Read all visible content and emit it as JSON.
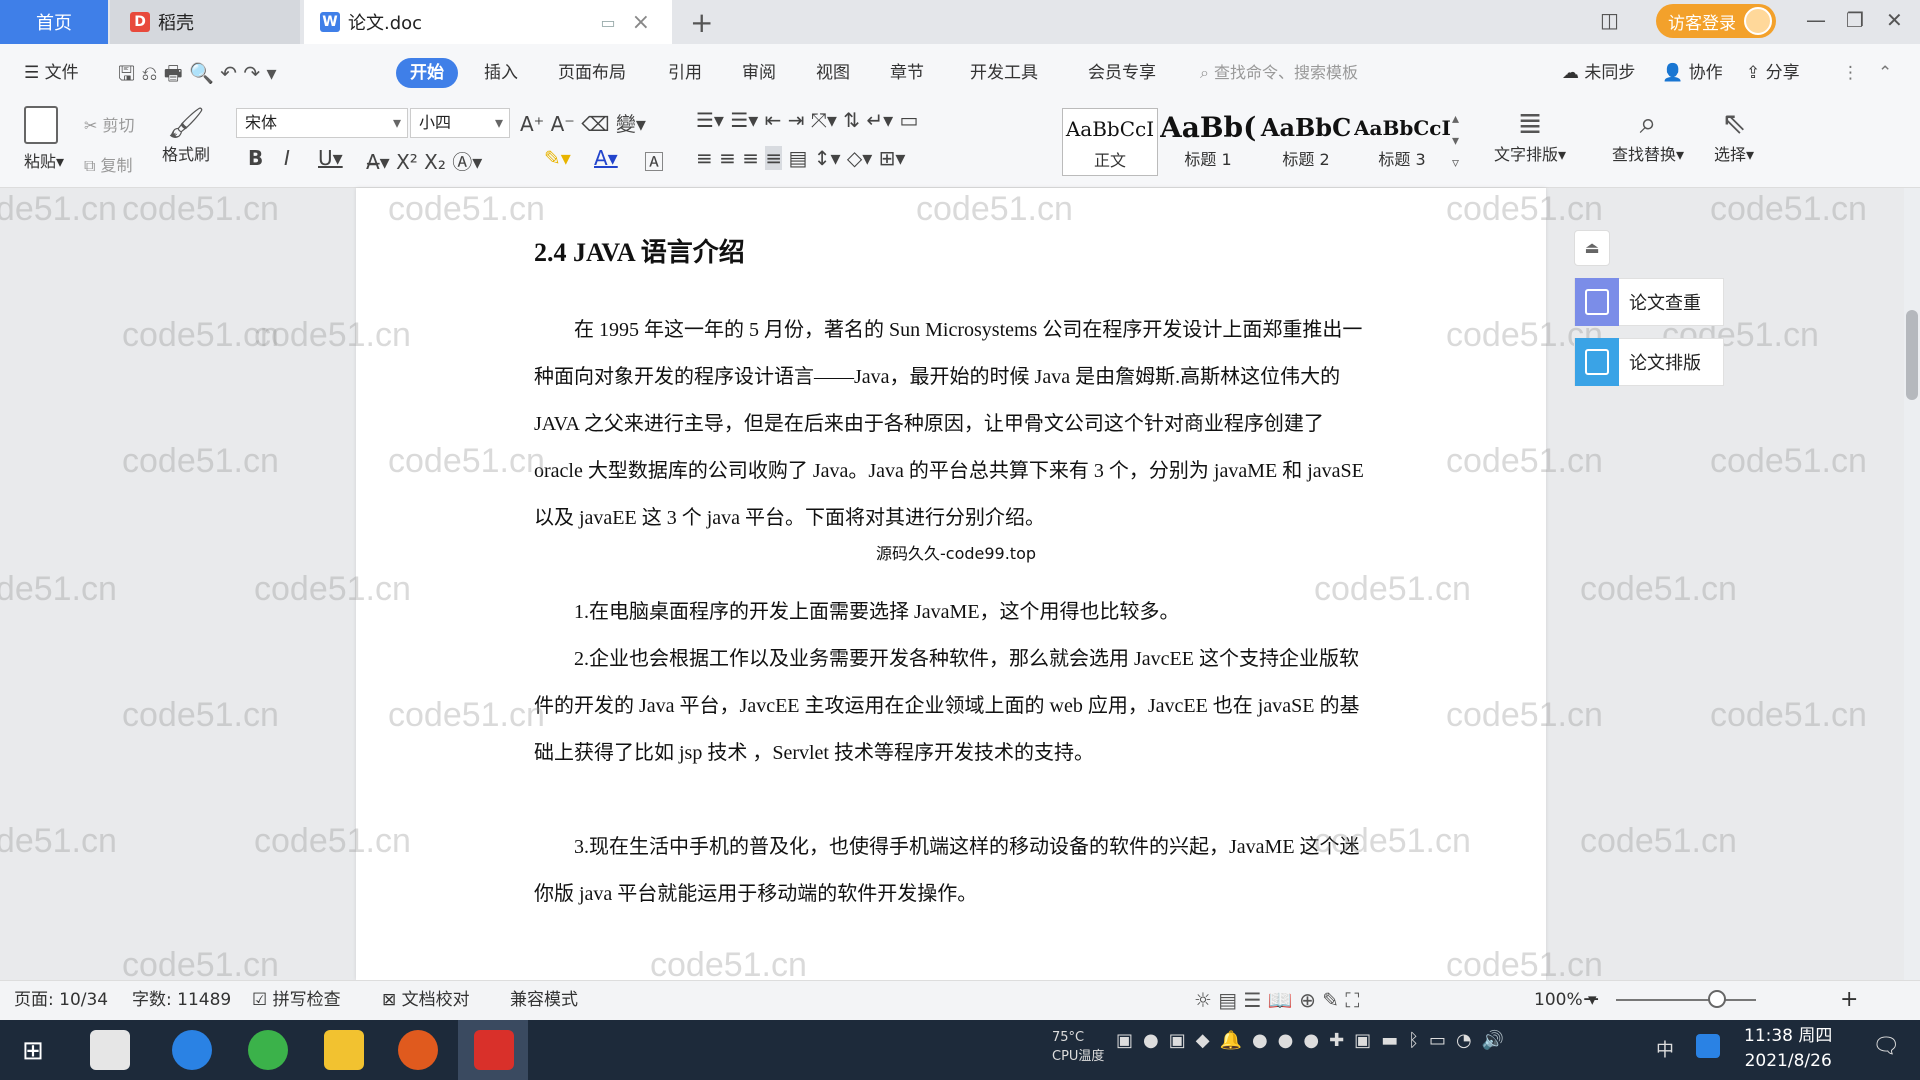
{
  "tabs": {
    "home": "首页",
    "daoke": "稻壳",
    "doc": "论文.doc",
    "login": "访客登录"
  },
  "menu": {
    "file": "文件",
    "items": [
      "开始",
      "插入",
      "页面布局",
      "引用",
      "审阅",
      "视图",
      "章节",
      "开发工具",
      "会员专享"
    ],
    "search_placeholder": "查找命令、搜索模板",
    "sync": "未同步",
    "collab": "协作",
    "share": "分享"
  },
  "ribbon": {
    "paste": "粘贴",
    "cut": "剪切",
    "copy": "复制",
    "format_painter": "格式刷",
    "font_name": "宋体",
    "font_size": "小四",
    "styles": [
      {
        "sample": "AaBbCcI",
        "name": "正文"
      },
      {
        "sample": "AaBb(",
        "name": "标题 1"
      },
      {
        "sample": "AaBbC",
        "name": "标题 2"
      },
      {
        "sample": "AaBbCcI",
        "name": "标题 3"
      }
    ],
    "text_layout": "文字排版",
    "find_replace": "查找替换",
    "select": "选择"
  },
  "document": {
    "heading": "2.4 JAVA 语言介绍",
    "p1": "在 1995 年这一年的 5 月份，著名的 Sun Microsystems 公司在程序开发设计上面郑重推出一种面向对象开发的程序设计语言——Java，最开始的时候 Java 是由詹姆斯.高斯林这位伟大的 JAVA 之父来进行主导，但是在后来由于各种原因，让甲骨文公司这个针对商业程序创建了 oracle 大型数据库的公司收购了 Java。Java 的平台总共算下来有 3 个，分别为 javaME 和 javaSE 以及 javaEE 这 3 个 java 平台。下面将对其进行分别介绍。",
    "note": "源码久久-code99.top",
    "p2": "1.在电脑桌面程序的开发上面需要选择 JavaME，这个用得也比较多。",
    "p3": "2.企业也会根据工作以及业务需要开发各种软件，那么就会选用 JavcEE 这个支持企业版软件的开发的 Java 平台，JavcEE 主攻运用在企业领域上面的 web 应用，JavcEE 也在 javaSE 的基础上获得了比如 jsp 技术 ，Servlet 技术等程序开发技术的支持。",
    "p4": "3.现在生活中手机的普及化，也使得手机端这样的移动设备的软件的兴起，JavaME 这个迷你版 java 平台就能运用于移动端的软件开发操作。"
  },
  "watermark": "code51.cn",
  "side_panel": {
    "check": "论文查重",
    "layout": "论文排版"
  },
  "status": {
    "page": "页面: 10/34",
    "words": "字数: 11489",
    "spell": "拼写检查",
    "proof": "文档校对",
    "compat": "兼容模式",
    "zoom": "100%"
  },
  "taskbar": {
    "cpu_temp": "75°C",
    "cpu_label": "CPU温度",
    "ime": "中",
    "time": "11:38 周四",
    "date": "2021/8/26"
  },
  "colors": {
    "accent": "#3f7fe8",
    "login": "#f3a12b",
    "taskbar": "#1d2a3a"
  }
}
